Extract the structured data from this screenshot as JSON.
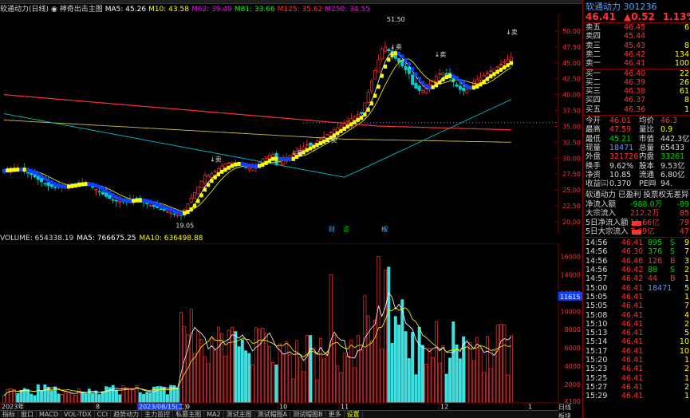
{
  "top_menu_stub": "",
  "info_line": [
    {
      "text": "软通动力(日线)",
      "color": "#d8d8d8"
    },
    {
      "text": "◉ 神奇出击主图",
      "color": "#d8d8d8"
    },
    {
      "text": "MA5: 45.26",
      "color": "#ffffff"
    },
    {
      "text": "M10: 43.58",
      "color": "#ffff00"
    },
    {
      "text": "M62: 39.49",
      "color": "#ff00ff"
    },
    {
      "text": "M81: 33.66",
      "color": "#00ff00"
    },
    {
      "text": "M125: 35.62",
      "color": "#ff3232"
    },
    {
      "text": "M250: 34.55",
      "color": "#ff00ff"
    }
  ],
  "chart_data": [
    {
      "type": "candlestick",
      "title": "",
      "y_ticks": [
        "50.00",
        "47.50",
        "45.00",
        "42.50",
        "40.00",
        "37.50",
        "35.00",
        "32.50",
        "30.00",
        "27.50",
        "25.00",
        "22.50",
        "20.00"
      ],
      "ylim": [
        20,
        52
      ],
      "annotations": [
        "51.50",
        "19.05",
        "↓卖",
        "↓卖",
        "↓卖",
        "↓卖",
        "↓卖",
        "↓卖"
      ],
      "markers": [
        "财",
        "滤",
        "榴"
      ],
      "x_labels": [
        "2023年",
        "8",
        "2023/08/15(二)",
        "9",
        "10",
        "11",
        "12",
        "1"
      ],
      "current_marker": "11615",
      "series": [
        {
          "name": "MA5",
          "color": "#ffffff"
        },
        {
          "name": "M10",
          "color": "#ffff00"
        },
        {
          "name": "M62",
          "color": "#ff00ff"
        },
        {
          "name": "M81",
          "color": "#00ff00"
        },
        {
          "name": "M125",
          "color": "#ff3232"
        },
        {
          "name": "M250",
          "color": "#ff00ff"
        }
      ],
      "grid": false
    },
    {
      "type": "bar",
      "title": "",
      "y_ticks": [
        "16000",
        "14000",
        "12000",
        "10000",
        "8000",
        "6000",
        "4000",
        "2000",
        "X100"
      ],
      "ylim": [
        0,
        17000
      ]
    }
  ],
  "vol_info": [
    {
      "text": "VOLUME: 654338.19",
      "color": "#d8d8d8"
    },
    {
      "text": "MA5: 766675.25",
      "color": "#ffffff"
    },
    {
      "text": "MA10: 636498.88",
      "color": "#ffff00"
    }
  ],
  "bottom_tabs": [
    {
      "label": "指标",
      "active": false
    },
    {
      "label": "窗口",
      "active": false
    },
    {
      "label": "MACD",
      "active": false
    },
    {
      "label": "VOL-TDX",
      "active": false
    },
    {
      "label": "CCI",
      "active": false
    },
    {
      "label": "趋势动力",
      "active": false
    },
    {
      "label": "主力监控",
      "active": false
    },
    {
      "label": "私募主图",
      "active": false
    },
    {
      "label": "MA2",
      "active": false
    },
    {
      "label": "测试主图",
      "active": false
    },
    {
      "label": "测试帽图A",
      "active": false
    },
    {
      "label": "测试帽图B",
      "active": false
    },
    {
      "label": "更多",
      "active": false
    },
    {
      "label": "设置",
      "active": true
    }
  ],
  "right_small": [
    "日线",
    "板块"
  ],
  "quote": {
    "title": "软通动力 301236",
    "price": "46.41",
    "change": "▲0.52",
    "pct": "1.13%",
    "asks": [
      {
        "label": "卖五",
        "price": "46.45",
        "vol": "6"
      },
      {
        "label": "卖四",
        "price": "45.44",
        "vol": ""
      },
      {
        "label": "卖三",
        "price": "45.43",
        "vol": "8"
      },
      {
        "label": "卖二",
        "price": "46.42",
        "vol": "134"
      },
      {
        "label": "卖一",
        "price": "46.41",
        "vol": "100"
      }
    ],
    "bids": [
      {
        "label": "买一",
        "price": "46.40",
        "vol": "22"
      },
      {
        "label": "买二",
        "price": "46.39",
        "vol": "26"
      },
      {
        "label": "买三",
        "price": "46.38",
        "vol": "61"
      },
      {
        "label": "买四",
        "price": "46.37",
        "vol": "8"
      },
      {
        "label": "买五",
        "price": "46.36",
        "vol": "1"
      }
    ],
    "stats": [
      {
        "l1": "今开",
        "v1": "46.01",
        "c1": "red",
        "l2": "均价",
        "v2": "46.3",
        "c2": "red"
      },
      {
        "l1": "最高",
        "v1": "47.59",
        "c1": "red",
        "l2": "量比",
        "v2": "0.9",
        "c2": "yellow"
      },
      {
        "l1": "最低",
        "v1": "45.21",
        "c1": "green",
        "l2": "市值",
        "v2": "442.3亿",
        "c2": "white"
      },
      {
        "l1": "现量",
        "v1": "18471",
        "c1": "blue",
        "l2": "总量",
        "v2": "65433",
        "c2": "white"
      },
      {
        "l1": "外盘",
        "v1": "321726",
        "c1": "red",
        "l2": "内盘",
        "v2": "33261",
        "c2": "green"
      },
      {
        "l1": "换手",
        "v1": "9.62%",
        "c1": "white",
        "l2": "股本",
        "v2": "9.53亿",
        "c2": "white"
      },
      {
        "l1": "净资",
        "v1": "10.85",
        "c1": "white",
        "l2": "流通",
        "v2": "6.80亿",
        "c2": "white"
      },
      {
        "l1": "收益㈢",
        "v1": "0.370",
        "c1": "white",
        "l2": "PE㈣",
        "v2": "94.",
        "c2": "white"
      }
    ],
    "note": "软通动力 已盈利 投票权无差异",
    "flows": [
      {
        "label": "净流入额",
        "value": "-988.0万",
        "extra": "-89",
        "color": "green",
        "bar": 0
      },
      {
        "label": "大宗流入",
        "value": "212.2万",
        "extra": "85",
        "color": "red",
        "bar": 0
      },
      {
        "label": "5日净流入额",
        "value": "11.66亿",
        "extra": "79",
        "color": "red",
        "bar": 1
      },
      {
        "label": "5日大宗流入",
        "value": "7.09亿",
        "extra": "47",
        "color": "red",
        "bar": 1
      }
    ],
    "ticks": [
      {
        "time": "14:56",
        "price": "46.41",
        "vol": "895",
        "bs": "S",
        "n": "9",
        "c": "red",
        "vc": "green"
      },
      {
        "time": "14:56",
        "price": "46.30",
        "vol": "376",
        "bs": "S",
        "n": "7",
        "c": "red",
        "vc": "green"
      },
      {
        "time": "14:56",
        "price": "46.46",
        "vol": "126",
        "bs": "B",
        "n": "3",
        "c": "red",
        "vc": "red"
      },
      {
        "time": "14:56",
        "price": "46.42",
        "vol": "88",
        "bs": "S",
        "n": "2",
        "c": "red",
        "vc": "green"
      },
      {
        "time": "14:57",
        "price": "46.42",
        "vol": "44",
        "bs": "B",
        "n": "1",
        "c": "red",
        "vc": "red"
      },
      {
        "time": "15:00",
        "price": "46.41",
        "vol": "18471",
        "bs": "",
        "n": "5",
        "c": "red",
        "vc": "blue"
      },
      {
        "time": "15:05",
        "price": "46.41",
        "vol": "",
        "bs": "",
        "n": "1",
        "c": "red",
        "vc": "yellow"
      },
      {
        "time": "15:05",
        "price": "46.41",
        "vol": "",
        "bs": "",
        "n": "7",
        "c": "red",
        "vc": "yellow"
      },
      {
        "time": "15:08",
        "price": "46.41",
        "vol": "",
        "bs": "",
        "n": "4",
        "c": "red",
        "vc": "yellow"
      },
      {
        "time": "15:10",
        "price": "46.41",
        "vol": "",
        "bs": "",
        "n": "2",
        "c": "red",
        "vc": "yellow"
      },
      {
        "time": "15:13",
        "price": "46.41",
        "vol": "",
        "bs": "",
        "n": "5",
        "c": "red",
        "vc": "yellow"
      },
      {
        "time": "15:14",
        "price": "46.41",
        "vol": "",
        "bs": "",
        "n": "10",
        "c": "red",
        "vc": "yellow"
      },
      {
        "time": "15:17",
        "price": "46.41",
        "vol": "",
        "bs": "",
        "n": "10",
        "c": "red",
        "vc": "yellow"
      },
      {
        "time": "15:20",
        "price": "46.41",
        "vol": "",
        "bs": "",
        "n": "1",
        "c": "red",
        "vc": "yellow"
      },
      {
        "time": "15:23",
        "price": "46.41",
        "vol": "",
        "bs": "",
        "n": "2",
        "c": "red",
        "vc": "yellow"
      },
      {
        "time": "15:25",
        "price": "46.41",
        "vol": "",
        "bs": "",
        "n": "1",
        "c": "red",
        "vc": "yellow"
      },
      {
        "time": "15:27",
        "price": "46.41",
        "vol": "",
        "bs": "",
        "n": "2",
        "c": "red",
        "vc": "yellow"
      },
      {
        "time": "15:29",
        "price": "46.41",
        "vol": "",
        "bs": "",
        "n": "1",
        "c": "red",
        "vc": "yellow"
      }
    ]
  }
}
